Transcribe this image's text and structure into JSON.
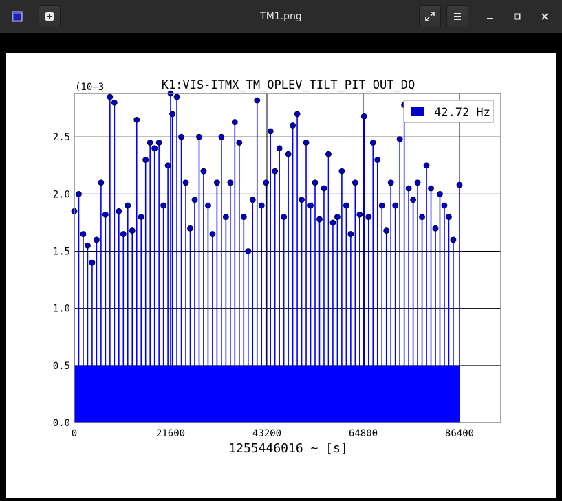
{
  "window": {
    "title": "TM1.png"
  },
  "colors": {
    "series": "#0000ff",
    "marker": "#0000cc",
    "frame": "#888888"
  },
  "chart_data": {
    "type": "line",
    "title": "K1:VIS-ITMX_TM_OPLEV_TILT_PIT_OUT_DQ",
    "xlabel": "1255446016 ~ [s]",
    "ylabel": "",
    "y_exponent": "(10−3",
    "xlim": [
      0,
      86400
    ],
    "ylim": [
      0,
      0.00288
    ],
    "xticks": [
      0,
      21600,
      43200,
      64800,
      86400
    ],
    "xtick_labels": [
      "0",
      "21600",
      "43200",
      "64800",
      "86400"
    ],
    "yticks": [
      0,
      0.0005,
      0.001,
      0.0015,
      0.002,
      0.0025
    ],
    "ytick_labels": [
      "0.0",
      "0.5",
      "1.0",
      "1.5",
      "2.0",
      "2.5"
    ],
    "grid": true,
    "legend_position": "top-right",
    "series": [
      {
        "name": "42.72 Hz",
        "style": "stem with circular markers",
        "x": [
          0,
          1000,
          2000,
          3000,
          4000,
          5000,
          6000,
          7000,
          8000,
          9000,
          10000,
          11000,
          12000,
          13000,
          14000,
          15000,
          16000,
          17000,
          18000,
          19000,
          20000,
          21000,
          21600,
          22000,
          23000,
          24000,
          25000,
          26000,
          27000,
          28000,
          29000,
          30000,
          31000,
          32000,
          33000,
          34000,
          35000,
          36000,
          37000,
          38000,
          39000,
          40000,
          41000,
          42000,
          43000,
          44000,
          45000,
          46000,
          47000,
          48000,
          49000,
          50000,
          51000,
          52000,
          53000,
          54000,
          55000,
          56000,
          57000,
          58000,
          59000,
          60000,
          61000,
          62000,
          63000,
          64000,
          65000,
          66000,
          67000,
          68000,
          69000,
          70000,
          71000,
          72000,
          73000,
          74000,
          75000,
          76000,
          77000,
          78000,
          79000,
          80000,
          81000,
          82000,
          83000,
          84000,
          85000,
          86400
        ],
        "y": [
          0.00185,
          0.002,
          0.00165,
          0.00155,
          0.0014,
          0.0016,
          0.0021,
          0.00182,
          0.00285,
          0.0028,
          0.00185,
          0.00165,
          0.0019,
          0.00168,
          0.00265,
          0.0018,
          0.0023,
          0.00245,
          0.0024,
          0.00245,
          0.0019,
          0.00225,
          0.00288,
          0.0027,
          0.00285,
          0.0025,
          0.0021,
          0.0017,
          0.00195,
          0.0025,
          0.0022,
          0.0019,
          0.00165,
          0.0021,
          0.0025,
          0.0018,
          0.0021,
          0.00263,
          0.00245,
          0.0018,
          0.0015,
          0.00195,
          0.00282,
          0.0019,
          0.0021,
          0.00255,
          0.0022,
          0.0024,
          0.0018,
          0.00235,
          0.0026,
          0.0027,
          0.00195,
          0.00245,
          0.0019,
          0.0021,
          0.00178,
          0.00205,
          0.00235,
          0.00175,
          0.0018,
          0.0022,
          0.0019,
          0.00165,
          0.0021,
          0.00182,
          0.00268,
          0.0018,
          0.00245,
          0.0023,
          0.0019,
          0.00168,
          0.0021,
          0.0019,
          0.00248,
          0.00278,
          0.00205,
          0.00195,
          0.0021,
          0.0018,
          0.00225,
          0.00205,
          0.0017,
          0.002,
          0.0019,
          0.0018,
          0.0016,
          0.00208
        ]
      }
    ]
  }
}
